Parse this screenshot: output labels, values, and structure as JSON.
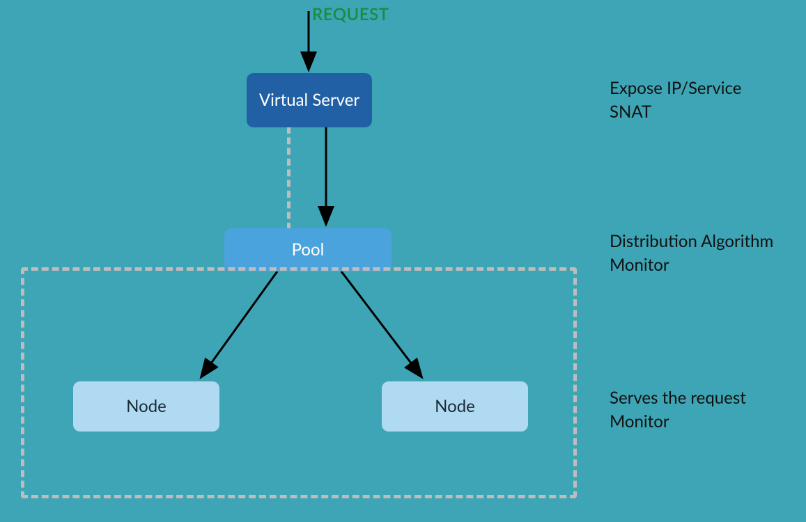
{
  "request_label": "REQUEST",
  "boxes": {
    "virtual_server": "Virtual Server",
    "pool": "Pool",
    "node_left": "Node",
    "node_right": "Node"
  },
  "annotations": {
    "virtual_server": {
      "line1": "Expose IP/Service",
      "line2": "SNAT"
    },
    "pool": {
      "line1": "Distribution Algorithm",
      "line2": "Monitor"
    },
    "node": {
      "line1": "Serves the request",
      "line2": "Monitor"
    }
  },
  "colors": {
    "background": "#3da5b5",
    "request": "#1a8c3e",
    "virtual_server_bg": "#2160a5",
    "pool_bg": "#4ba3de",
    "node_bg": "#b0daf2",
    "dashed": "#bdbdbd",
    "arrow": "#000000"
  },
  "diagram_structure": {
    "entry": "request",
    "flow": [
      {
        "from": "request",
        "to": "virtual_server",
        "style": "solid"
      },
      {
        "from": "virtual_server",
        "to": "pool",
        "style": "solid_and_dashed"
      },
      {
        "from": "pool",
        "to": "node_left",
        "style": "solid"
      },
      {
        "from": "pool",
        "to": "node_right",
        "style": "solid"
      }
    ],
    "groups": [
      {
        "contains": [
          "node_left",
          "node_right"
        ],
        "style": "dashed_box",
        "parent": "pool"
      }
    ]
  }
}
